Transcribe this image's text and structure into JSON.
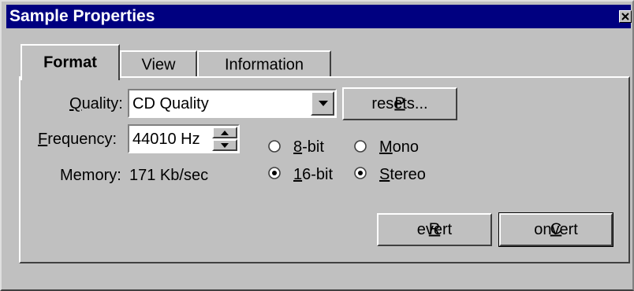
{
  "window": {
    "title": "Sample Properties"
  },
  "tabs": [
    {
      "label": "Format",
      "active": true
    },
    {
      "label": "View",
      "active": false
    },
    {
      "label": "Information",
      "active": false
    }
  ],
  "format": {
    "quality": {
      "label_mnemonic": "Q",
      "label_rest": "uality:",
      "value": "CD Quality"
    },
    "presets_button": {
      "mnemonic": "P",
      "rest": "resets..."
    },
    "frequency": {
      "label_mnemonic": "F",
      "label_rest": "requency:",
      "value": "44010 Hz"
    },
    "memory": {
      "label": "Memory:",
      "value": "171 Kb/sec"
    },
    "bit_depth": [
      {
        "mnemonic": "8",
        "rest": "-bit",
        "selected": false
      },
      {
        "mnemonic": "1",
        "rest": "6-bit",
        "selected": true
      }
    ],
    "channels": [
      {
        "mnemonic": "M",
        "rest": "ono",
        "selected": false
      },
      {
        "mnemonic": "S",
        "rest": "tereo",
        "selected": true
      }
    ],
    "revert_button": {
      "mnemonic": "R",
      "rest": "evert"
    },
    "convert_button": {
      "mnemonic": "C",
      "rest": "onvert"
    }
  },
  "icons": {
    "close": "close-icon",
    "dropdown": "chevron-down-icon",
    "spin_up": "spin-up-icon",
    "spin_down": "spin-down-icon"
  },
  "colors": {
    "titlebar": "#000080",
    "face": "#c0c0c0"
  }
}
